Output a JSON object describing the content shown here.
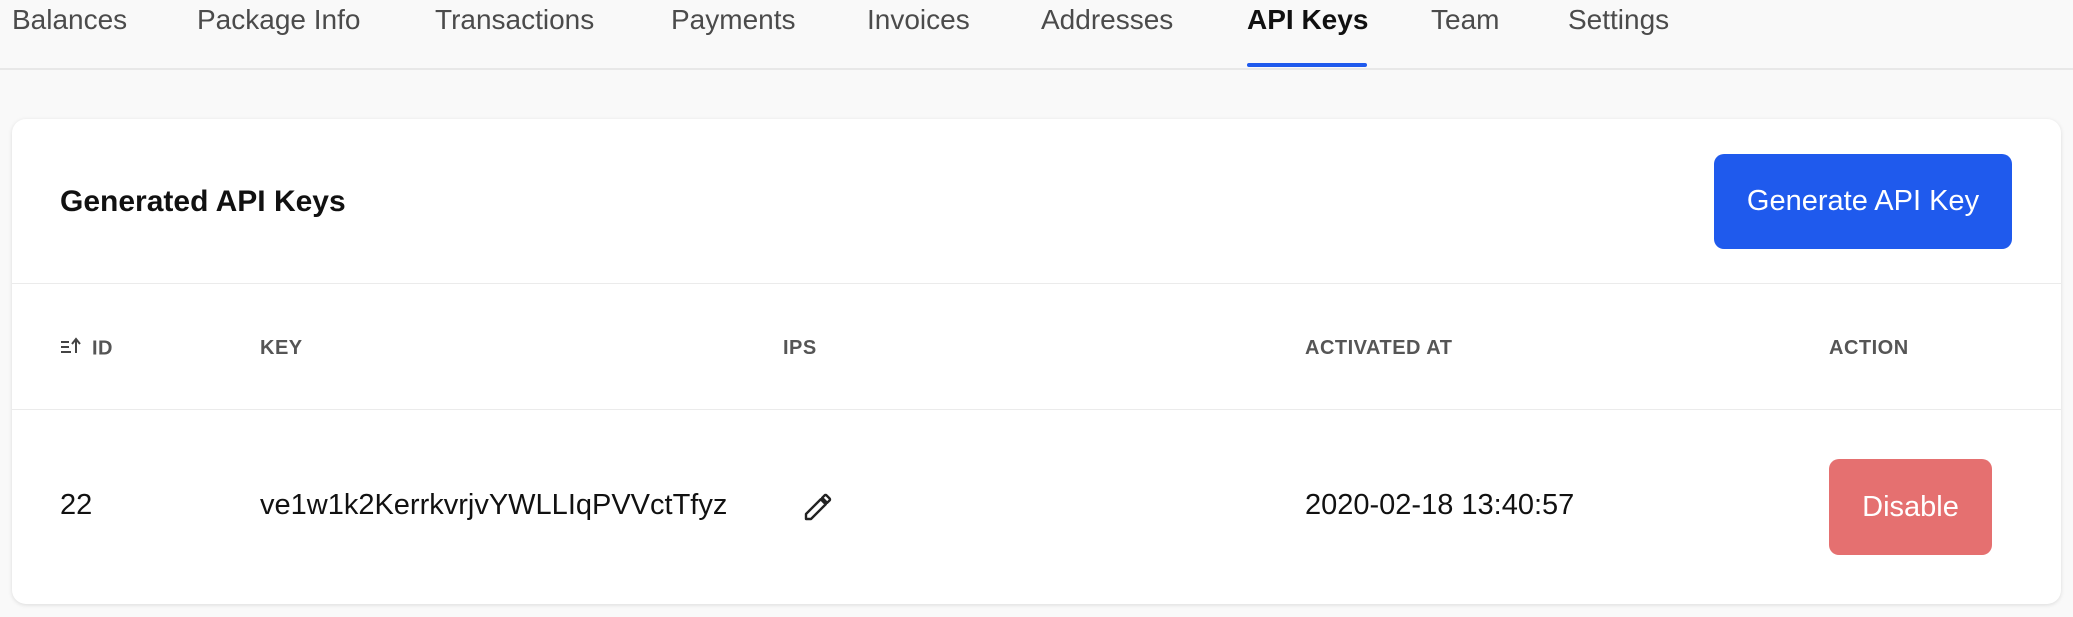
{
  "tabs": [
    {
      "label": "Balances"
    },
    {
      "label": "Package Info"
    },
    {
      "label": "Transactions"
    },
    {
      "label": "Payments"
    },
    {
      "label": "Invoices"
    },
    {
      "label": "Addresses"
    },
    {
      "label": "API Keys",
      "active": true
    },
    {
      "label": "Team"
    },
    {
      "label": "Settings"
    }
  ],
  "card": {
    "title": "Generated API Keys",
    "generate_button": "Generate API Key"
  },
  "table": {
    "columns": [
      "ID",
      "KEY",
      "IPS",
      "ACTIVATED AT",
      "ACTION"
    ],
    "sort_icon": "sort-ascending-icon",
    "rows": [
      {
        "id": "22",
        "key": "ve1w1k2KerrkvrjvYWLLIqPVVctTfyz",
        "ips_icon": "pencil-icon",
        "activated_at": "2020-02-18 13:40:57",
        "action": "Disable"
      }
    ]
  },
  "colors": {
    "accent": "#1f5aed",
    "danger": "#e57070"
  }
}
